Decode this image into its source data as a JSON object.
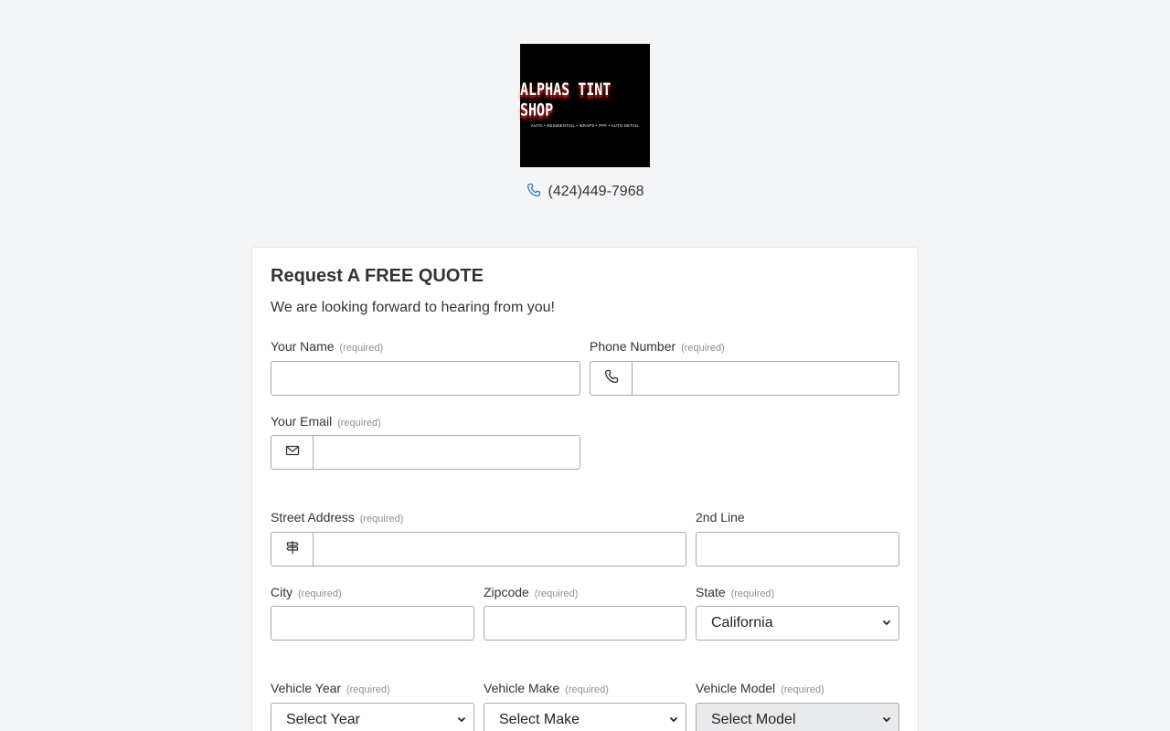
{
  "brand": {
    "logo_title": "ALPHAS TINT SHOP",
    "logo_tagline": "AUTO • RESIDENTIAL • WRAPS • PPF • AUTO DETAIL",
    "phone": "(424)449-7968"
  },
  "form": {
    "title": "Request A FREE QUOTE",
    "subtitle": "We are looking forward to hearing from you!",
    "required_text": "(required)",
    "name_label": "Your Name",
    "phone_label": "Phone Number",
    "email_label": "Your Email",
    "street_label": "Street Address",
    "line2_label": "2nd Line",
    "city_label": "City",
    "zip_label": "Zipcode",
    "state_label": "State",
    "state_value": "California",
    "year_label": "Vehicle Year",
    "year_value": "Select Year",
    "make_label": "Vehicle Make",
    "make_value": "Select Make",
    "model_label": "Vehicle Model",
    "model_value": "Select Model"
  },
  "icons": {
    "phone": "phone-icon",
    "email": "envelope-icon",
    "address": "signpost-icon",
    "dropdown": "chevron-down-icon"
  },
  "colors": {
    "page_bg": "#f4f5f7",
    "accent_icon": "#2f7fc1",
    "disabled_select": "#e9eaec"
  }
}
